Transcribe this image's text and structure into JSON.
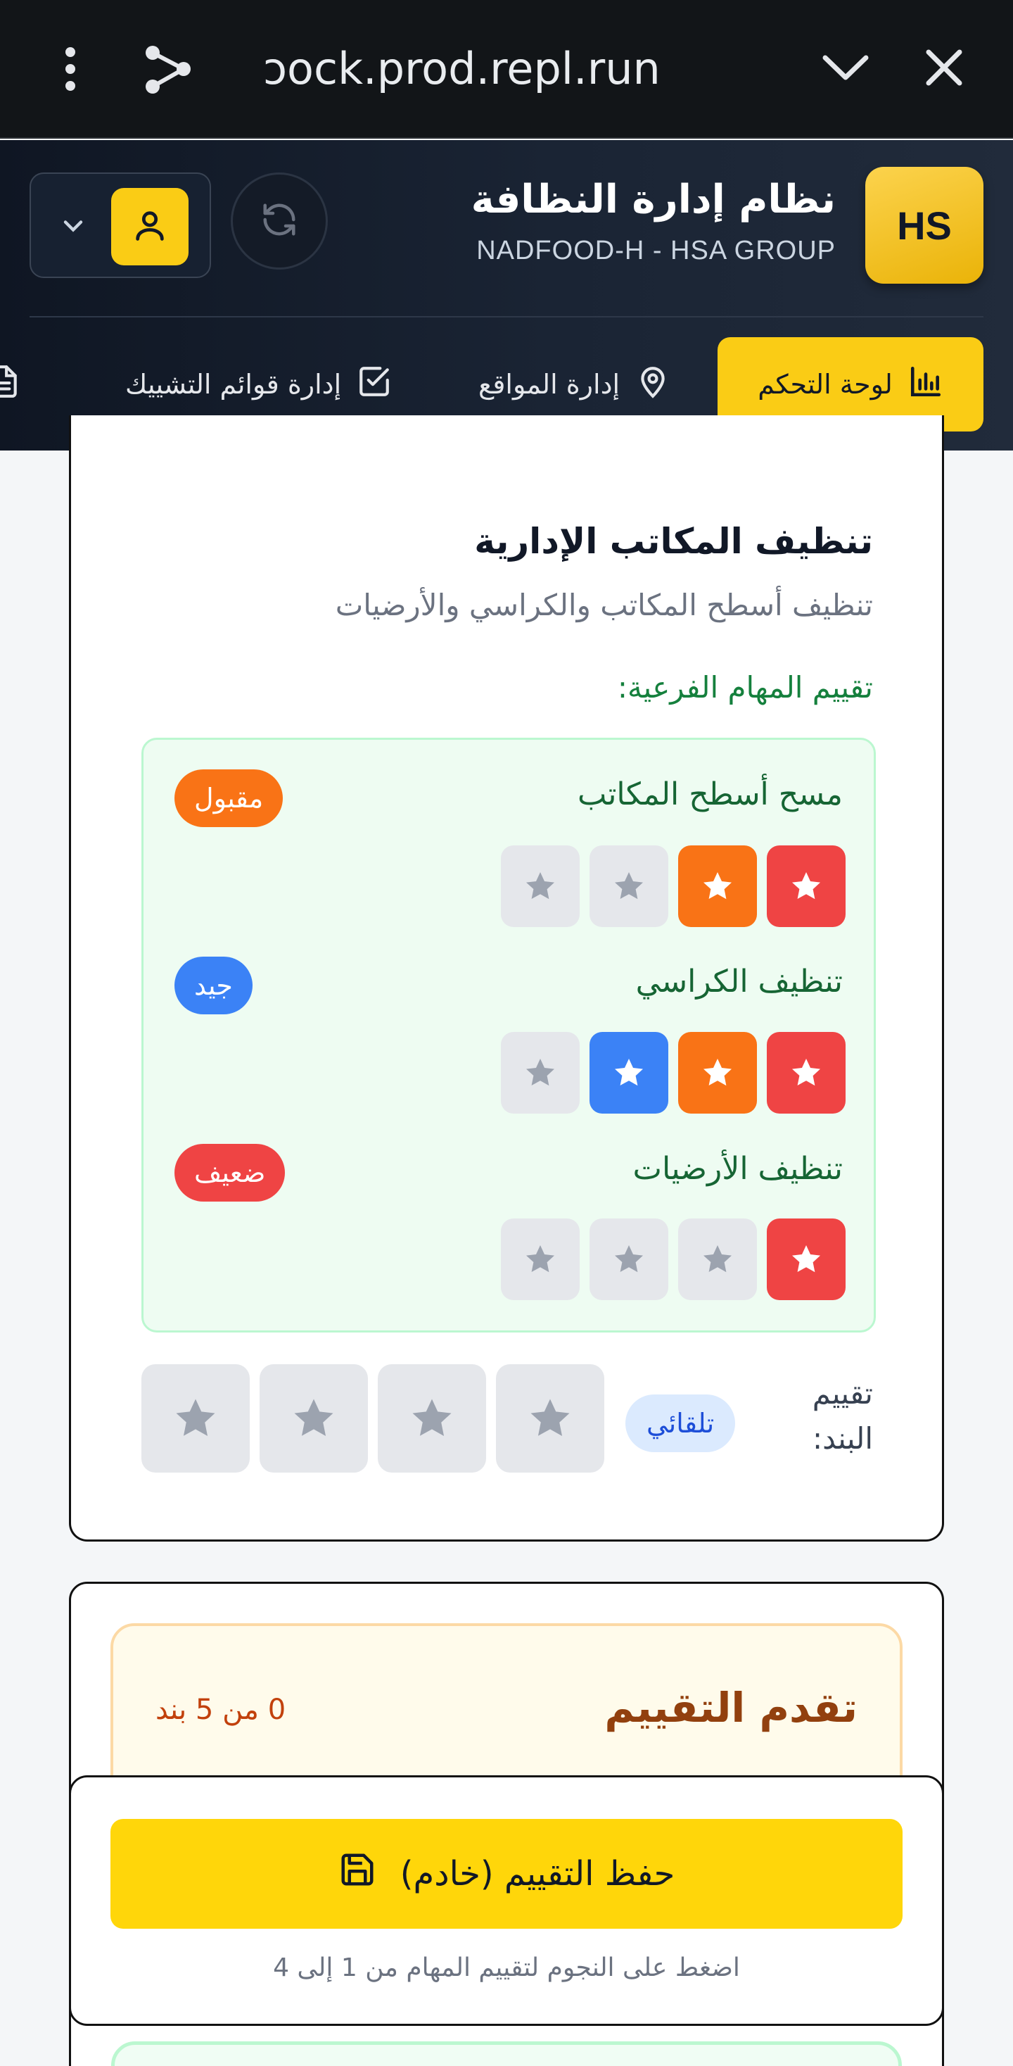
{
  "browser": {
    "url": "ɔock.prod.repl.run",
    "menu_icon": "more-vertical-icon",
    "share_icon": "share-icon",
    "chevron_icon": "chevron-down-icon",
    "close_icon": "close-icon"
  },
  "header": {
    "logo_text": "HS",
    "title": "نظام إدارة النظافة",
    "subtitle": "NADFOOD-H - HSA GROUP",
    "refresh_icon": "refresh-icon",
    "user_icon": "user-icon"
  },
  "nav": {
    "tabs": [
      {
        "label": "لوحة التحكم",
        "icon": "bar-chart-icon",
        "active": true
      },
      {
        "label": "إدارة المواقع",
        "icon": "map-pin-icon",
        "active": false
      },
      {
        "label": "إدارة قوائم التشييك",
        "icon": "checkbox-icon",
        "active": false
      },
      {
        "label": "",
        "icon": "document-icon",
        "active": false
      }
    ]
  },
  "task": {
    "title": "تنظيف المكاتب الإدارية",
    "description": "تنظيف أسطح المكاتب والكراسي والأرضيات",
    "subtasks_heading": "تقييم المهام الفرعية:",
    "subtasks": [
      {
        "name": "مسح أسطح المكاتب",
        "badge": "مقبول",
        "badge_color": "#f97316",
        "rating": 2,
        "star_colors": [
          "#ef4444",
          "#f97316"
        ]
      },
      {
        "name": "تنظيف الكراسي",
        "badge": "جيد",
        "badge_color": "#3b82f6",
        "rating": 3,
        "star_colors": [
          "#ef4444",
          "#f97316",
          "#3b82f6"
        ]
      },
      {
        "name": "تنظيف الأرضيات",
        "badge": "ضعيف",
        "badge_color": "#ef4444",
        "rating": 1,
        "star_colors": [
          "#ef4444"
        ]
      }
    ],
    "item_rating_label": "تقييم البند:",
    "auto_badge": "تلقائي",
    "item_rating": 0
  },
  "progress": {
    "title": "تقدم التقييم",
    "count_text": "0 من 5 بند"
  },
  "save": {
    "button_label": "حفظ التقييم (خادم)",
    "icon": "save-icon",
    "hint": "اضغط على النجوم لتقييم المهام من 1 إلى 4"
  },
  "colors": {
    "accent": "#facc15",
    "header_bg": "#0f1623",
    "rating_red": "#ef4444",
    "rating_orange": "#f97316",
    "rating_blue": "#3b82f6"
  }
}
